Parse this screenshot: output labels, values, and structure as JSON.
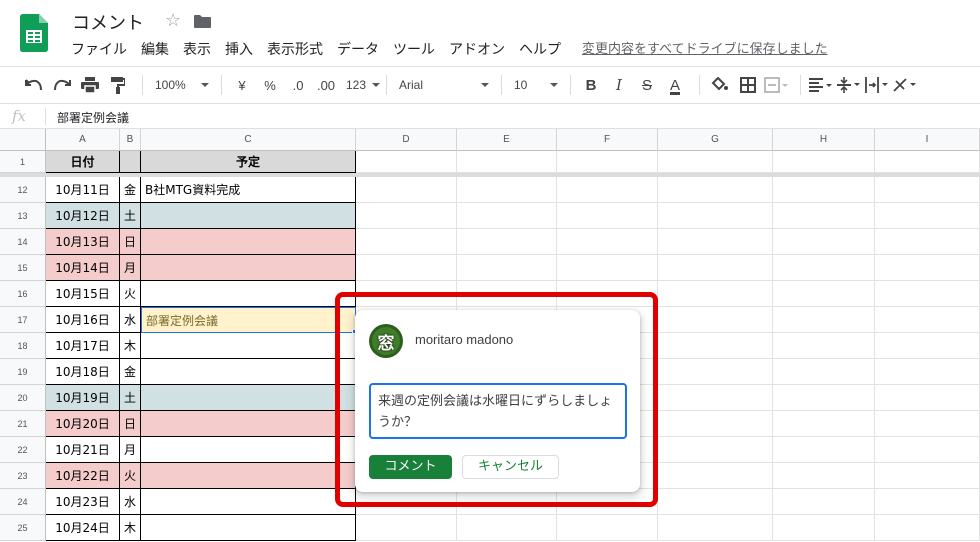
{
  "app": {
    "title": "コメント",
    "save_status": "変更内容をすべてドライブに保存しました"
  },
  "menu": [
    "ファイル",
    "編集",
    "表示",
    "挿入",
    "表示形式",
    "データ",
    "ツール",
    "アドオン",
    "ヘルプ"
  ],
  "toolbar": {
    "zoom": "100%",
    "currency": "¥",
    "percent": "%",
    "decimal_less": ".0",
    "decimal_more": ".00",
    "format_more": "123",
    "font": "Arial",
    "font_size": "10",
    "bold": "B",
    "italic": "I",
    "strike": "S",
    "text_color": "A"
  },
  "formula": {
    "fx": "fx",
    "content": "部署定例会議"
  },
  "grid": {
    "columns": [
      "A",
      "B",
      "C",
      "D",
      "E",
      "F",
      "G",
      "H",
      "I"
    ],
    "header_row": {
      "num": "1",
      "a": "日付",
      "b": "",
      "c": "予定"
    },
    "rows": [
      {
        "num": "12",
        "date": "10月11日",
        "day": "金",
        "plan": "B社MTG資料完成",
        "fill": "#ffffff"
      },
      {
        "num": "13",
        "date": "10月12日",
        "day": "土",
        "plan": "",
        "fill": "#d0e0e3"
      },
      {
        "num": "14",
        "date": "10月13日",
        "day": "日",
        "plan": "",
        "fill": "#f4cccc"
      },
      {
        "num": "15",
        "date": "10月14日",
        "day": "月",
        "plan": "",
        "fill": "#f4cccc"
      },
      {
        "num": "16",
        "date": "10月15日",
        "day": "火",
        "plan": "",
        "fill": "#ffffff"
      },
      {
        "num": "17",
        "date": "10月16日",
        "day": "水",
        "plan": "部署定例会議",
        "fill": "#ffffff",
        "plan_fill": "#fff2cc"
      },
      {
        "num": "18",
        "date": "10月17日",
        "day": "木",
        "plan": "",
        "fill": "#ffffff"
      },
      {
        "num": "19",
        "date": "10月18日",
        "day": "金",
        "plan": "",
        "fill": "#ffffff"
      },
      {
        "num": "20",
        "date": "10月19日",
        "day": "土",
        "plan": "",
        "fill": "#d0e0e3"
      },
      {
        "num": "21",
        "date": "10月20日",
        "day": "日",
        "plan": "",
        "fill": "#f4cccc"
      },
      {
        "num": "22",
        "date": "10月21日",
        "day": "月",
        "plan": "",
        "fill": "#ffffff"
      },
      {
        "num": "23",
        "date": "10月22日",
        "day": "火",
        "plan": "",
        "fill": "#f4cccc"
      },
      {
        "num": "24",
        "date": "10月23日",
        "day": "水",
        "plan": "",
        "fill": "#ffffff"
      },
      {
        "num": "25",
        "date": "10月24日",
        "day": "木",
        "plan": "",
        "fill": "#ffffff"
      }
    ]
  },
  "comment": {
    "user": "moritaro madono",
    "avatar_char": "窓",
    "text": "来週の定例会議は水曜日にずらしましょうか？",
    "submit_label": "コメント",
    "cancel_label": "キャンセル"
  }
}
